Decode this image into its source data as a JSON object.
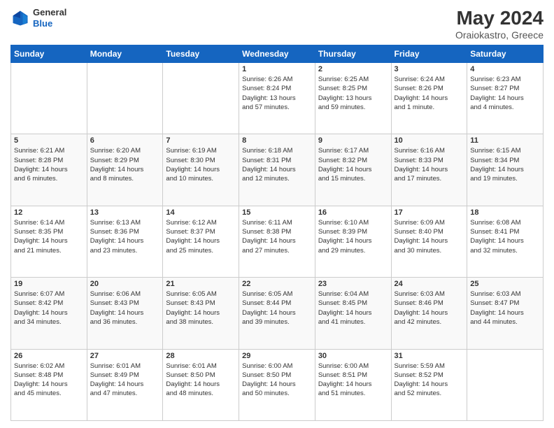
{
  "header": {
    "logo_line1": "General",
    "logo_line2": "Blue",
    "title": "May 2024",
    "location": "Oraiokastro, Greece"
  },
  "weekdays": [
    "Sunday",
    "Monday",
    "Tuesday",
    "Wednesday",
    "Thursday",
    "Friday",
    "Saturday"
  ],
  "weeks": [
    [
      {
        "day": "",
        "info": ""
      },
      {
        "day": "",
        "info": ""
      },
      {
        "day": "",
        "info": ""
      },
      {
        "day": "1",
        "info": "Sunrise: 6:26 AM\nSunset: 8:24 PM\nDaylight: 13 hours\nand 57 minutes."
      },
      {
        "day": "2",
        "info": "Sunrise: 6:25 AM\nSunset: 8:25 PM\nDaylight: 13 hours\nand 59 minutes."
      },
      {
        "day": "3",
        "info": "Sunrise: 6:24 AM\nSunset: 8:26 PM\nDaylight: 14 hours\nand 1 minute."
      },
      {
        "day": "4",
        "info": "Sunrise: 6:23 AM\nSunset: 8:27 PM\nDaylight: 14 hours\nand 4 minutes."
      }
    ],
    [
      {
        "day": "5",
        "info": "Sunrise: 6:21 AM\nSunset: 8:28 PM\nDaylight: 14 hours\nand 6 minutes."
      },
      {
        "day": "6",
        "info": "Sunrise: 6:20 AM\nSunset: 8:29 PM\nDaylight: 14 hours\nand 8 minutes."
      },
      {
        "day": "7",
        "info": "Sunrise: 6:19 AM\nSunset: 8:30 PM\nDaylight: 14 hours\nand 10 minutes."
      },
      {
        "day": "8",
        "info": "Sunrise: 6:18 AM\nSunset: 8:31 PM\nDaylight: 14 hours\nand 12 minutes."
      },
      {
        "day": "9",
        "info": "Sunrise: 6:17 AM\nSunset: 8:32 PM\nDaylight: 14 hours\nand 15 minutes."
      },
      {
        "day": "10",
        "info": "Sunrise: 6:16 AM\nSunset: 8:33 PM\nDaylight: 14 hours\nand 17 minutes."
      },
      {
        "day": "11",
        "info": "Sunrise: 6:15 AM\nSunset: 8:34 PM\nDaylight: 14 hours\nand 19 minutes."
      }
    ],
    [
      {
        "day": "12",
        "info": "Sunrise: 6:14 AM\nSunset: 8:35 PM\nDaylight: 14 hours\nand 21 minutes."
      },
      {
        "day": "13",
        "info": "Sunrise: 6:13 AM\nSunset: 8:36 PM\nDaylight: 14 hours\nand 23 minutes."
      },
      {
        "day": "14",
        "info": "Sunrise: 6:12 AM\nSunset: 8:37 PM\nDaylight: 14 hours\nand 25 minutes."
      },
      {
        "day": "15",
        "info": "Sunrise: 6:11 AM\nSunset: 8:38 PM\nDaylight: 14 hours\nand 27 minutes."
      },
      {
        "day": "16",
        "info": "Sunrise: 6:10 AM\nSunset: 8:39 PM\nDaylight: 14 hours\nand 29 minutes."
      },
      {
        "day": "17",
        "info": "Sunrise: 6:09 AM\nSunset: 8:40 PM\nDaylight: 14 hours\nand 30 minutes."
      },
      {
        "day": "18",
        "info": "Sunrise: 6:08 AM\nSunset: 8:41 PM\nDaylight: 14 hours\nand 32 minutes."
      }
    ],
    [
      {
        "day": "19",
        "info": "Sunrise: 6:07 AM\nSunset: 8:42 PM\nDaylight: 14 hours\nand 34 minutes."
      },
      {
        "day": "20",
        "info": "Sunrise: 6:06 AM\nSunset: 8:43 PM\nDaylight: 14 hours\nand 36 minutes."
      },
      {
        "day": "21",
        "info": "Sunrise: 6:05 AM\nSunset: 8:43 PM\nDaylight: 14 hours\nand 38 minutes."
      },
      {
        "day": "22",
        "info": "Sunrise: 6:05 AM\nSunset: 8:44 PM\nDaylight: 14 hours\nand 39 minutes."
      },
      {
        "day": "23",
        "info": "Sunrise: 6:04 AM\nSunset: 8:45 PM\nDaylight: 14 hours\nand 41 minutes."
      },
      {
        "day": "24",
        "info": "Sunrise: 6:03 AM\nSunset: 8:46 PM\nDaylight: 14 hours\nand 42 minutes."
      },
      {
        "day": "25",
        "info": "Sunrise: 6:03 AM\nSunset: 8:47 PM\nDaylight: 14 hours\nand 44 minutes."
      }
    ],
    [
      {
        "day": "26",
        "info": "Sunrise: 6:02 AM\nSunset: 8:48 PM\nDaylight: 14 hours\nand 45 minutes."
      },
      {
        "day": "27",
        "info": "Sunrise: 6:01 AM\nSunset: 8:49 PM\nDaylight: 14 hours\nand 47 minutes."
      },
      {
        "day": "28",
        "info": "Sunrise: 6:01 AM\nSunset: 8:50 PM\nDaylight: 14 hours\nand 48 minutes."
      },
      {
        "day": "29",
        "info": "Sunrise: 6:00 AM\nSunset: 8:50 PM\nDaylight: 14 hours\nand 50 minutes."
      },
      {
        "day": "30",
        "info": "Sunrise: 6:00 AM\nSunset: 8:51 PM\nDaylight: 14 hours\nand 51 minutes."
      },
      {
        "day": "31",
        "info": "Sunrise: 5:59 AM\nSunset: 8:52 PM\nDaylight: 14 hours\nand 52 minutes."
      },
      {
        "day": "",
        "info": ""
      }
    ]
  ]
}
